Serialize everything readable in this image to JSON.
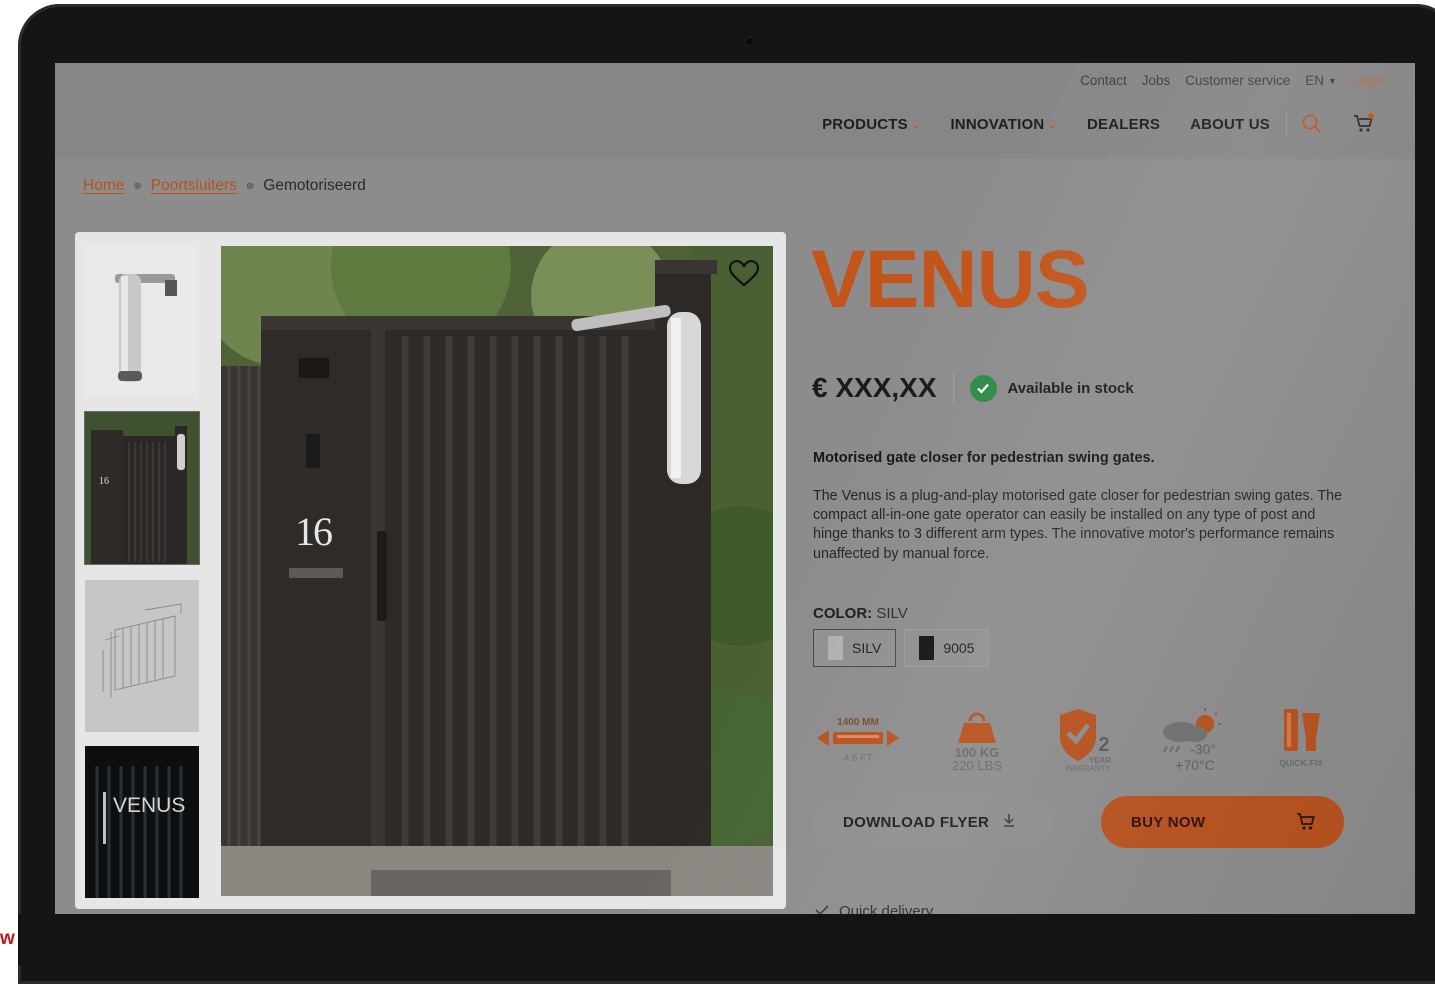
{
  "topnav": {
    "contact": "Contact",
    "jobs": "Jobs",
    "customer_service": "Customer service",
    "language": "EN",
    "login": "Login"
  },
  "mainnav": {
    "products": "PRODUCTS",
    "innovation": "INNOVATION",
    "dealers": "DEALERS",
    "about": "ABOUT US"
  },
  "breadcrumb": {
    "home": "Home",
    "category": "Poortsluiters",
    "current": "Gemotoriseerd"
  },
  "gallery": {
    "thumb4_text": "VENUS",
    "house_number": "16"
  },
  "product": {
    "title": "VENUS",
    "price": "€ XXX,XX",
    "stock": "Available in stock",
    "short_description": "Motorised gate closer for pedestrian swing gates.",
    "description": "The Venus is a plug-and-play motorised gate closer for pedestrian swing gates. The compact all-in-one gate operator can easily be installed on any type of post and hinge thanks to 3 different arm types. The innovative motor's performance remains unaffected by manual force.",
    "color_label": "COLOR:",
    "color_value": "SILV",
    "colors": [
      {
        "label": "SILV",
        "hex": "#b0b0b0"
      },
      {
        "label": "9005",
        "hex": "#141414"
      }
    ]
  },
  "features": {
    "width_mm": "1400 MM",
    "width_ft": "4.6 FT",
    "weight_kg": "100 KG",
    "weight_lbs": "220 LBS",
    "warranty_years": "2",
    "warranty_word1": "YEAR",
    "warranty_word2": "WARRANTY",
    "temp_low": "-30°",
    "temp_high": "+70°C",
    "quickfix": "QUICK-FIX"
  },
  "buttons": {
    "download": "DOWNLOAD FLYER",
    "buy": "BUY NOW"
  },
  "quick_delivery": "Quick delivery",
  "bottom_mark": "w",
  "colors": {
    "accent": "#c3541b",
    "stock_green": "#2f8a46",
    "screen_bg": "#8c8c8c"
  }
}
